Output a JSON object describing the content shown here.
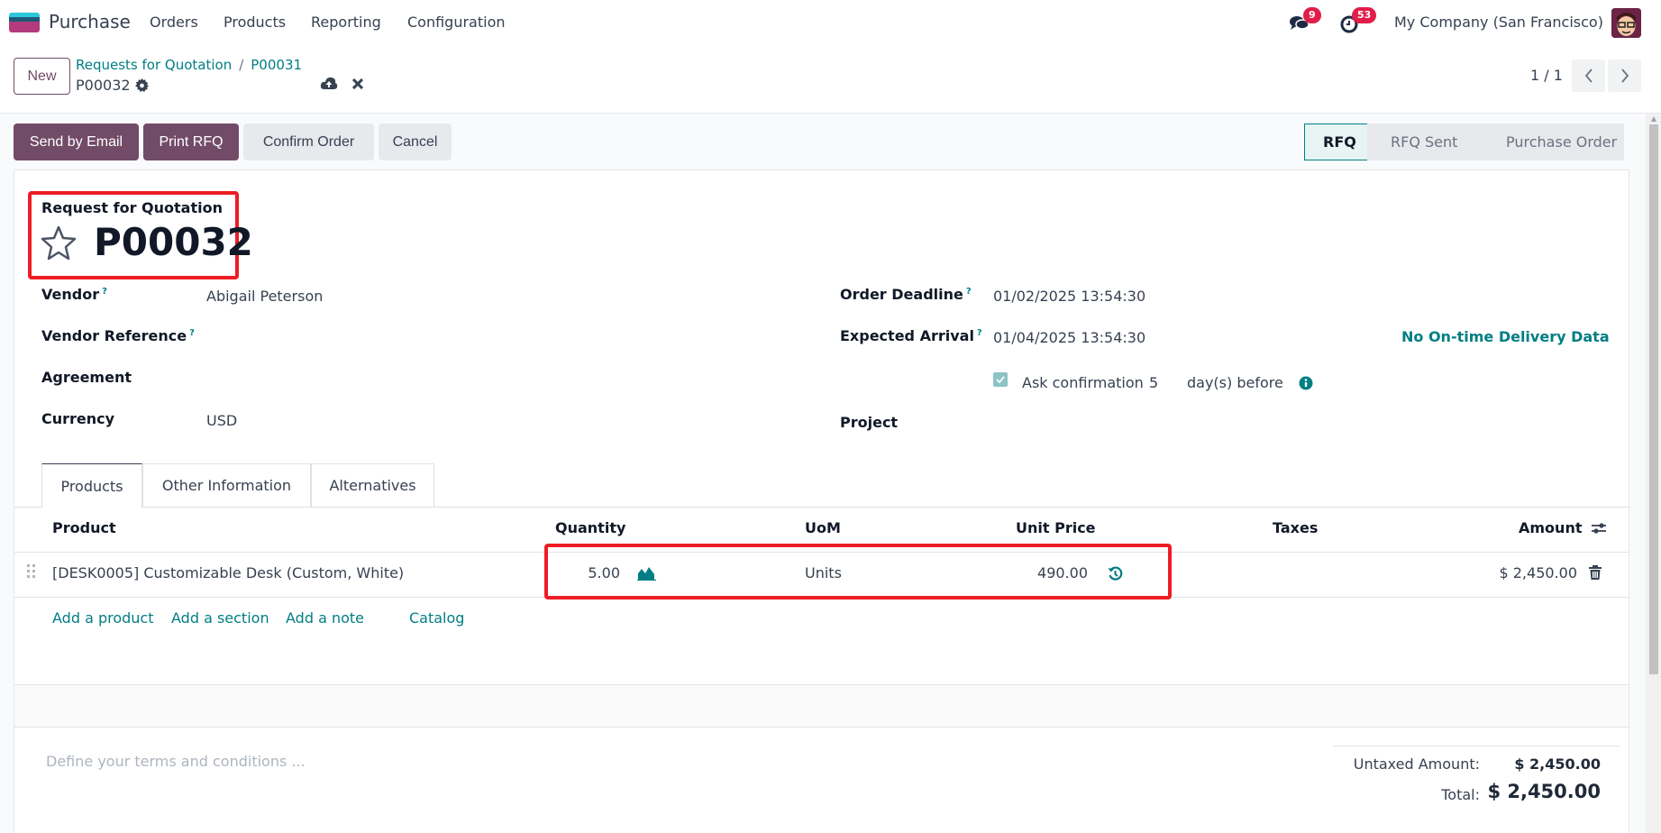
{
  "navbar": {
    "app_name": "Purchase",
    "menu": [
      "Orders",
      "Products",
      "Reporting",
      "Configuration"
    ],
    "messages_icon": "chat-icon",
    "messages_count": "9",
    "activities_icon": "clock-icon",
    "activities_count": "53",
    "company": "My Company (San Francisco)",
    "avatar_icon": "user-avatar"
  },
  "control_panel": {
    "new_label": "New",
    "breadcrumb": [
      "Requests for Quotation",
      "P00031"
    ],
    "breadcrumb_separator": "/",
    "record_name": "P00032",
    "gear_icon": "gear-icon",
    "save_icon": "cloud-upload-icon",
    "discard_icon": "close-icon",
    "pager": "1 / 1",
    "prev_icon": "chevron-left-icon",
    "next_icon": "chevron-right-icon"
  },
  "actions": {
    "send_by_email": "Send by Email",
    "print_rfq": "Print RFQ",
    "confirm_order": "Confirm Order",
    "cancel": "Cancel"
  },
  "statusbar": {
    "stages": [
      "RFQ",
      "RFQ Sent",
      "Purchase Order"
    ],
    "active": "RFQ"
  },
  "form": {
    "doc_type": "Request for Quotation",
    "name": "P00032",
    "favorite_icon": "star-icon",
    "left_fields": [
      {
        "label": "Vendor",
        "help": "?",
        "value": "Abigail Peterson"
      },
      {
        "label": "Vendor Reference",
        "help": "?",
        "value": ""
      },
      {
        "label": "Agreement",
        "help": "",
        "value": ""
      },
      {
        "label": "Currency",
        "help": "",
        "value": "USD"
      }
    ],
    "right_fields": [
      {
        "label": "Order Deadline",
        "help": "?",
        "value": "01/02/2025 13:54:30"
      },
      {
        "label": "Expected Arrival",
        "help": "?",
        "value": "01/04/2025 13:54:30"
      },
      {
        "label": "Project",
        "help": "",
        "value": ""
      }
    ],
    "on_time_delivery": "No On-time Delivery Data",
    "ask_confirmation": {
      "checked": true,
      "label": "Ask confirmation",
      "days": "5",
      "suffix": "day(s) before",
      "info_icon": "info-icon"
    }
  },
  "tabs": [
    "Products",
    "Other Information",
    "Alternatives"
  ],
  "active_tab": "Products",
  "lines": {
    "headers": {
      "product": "Product",
      "quantity": "Quantity",
      "uom": "UoM",
      "unit_price": "Unit Price",
      "taxes": "Taxes",
      "amount": "Amount"
    },
    "rows": [
      {
        "product": "[DESK0005] Customizable Desk (Custom, White)",
        "quantity": "5.00",
        "uom": "Units",
        "unit_price": "490.00",
        "taxes": "",
        "amount": "$ 2,450.00"
      }
    ],
    "add_product": "Add a product",
    "add_section": "Add a section",
    "add_note": "Add a note",
    "catalog": "Catalog"
  },
  "notes_placeholder": "Define your terms and conditions ...",
  "totals": {
    "untaxed_label": "Untaxed Amount:",
    "untaxed_value": "$ 2,450.00",
    "total_label": "Total:",
    "total_value": "$ 2,450.00"
  },
  "colors": {
    "brand": "#714b67",
    "link": "#017e84",
    "highlight": "#ee1c24",
    "badge": "#e11d48"
  }
}
